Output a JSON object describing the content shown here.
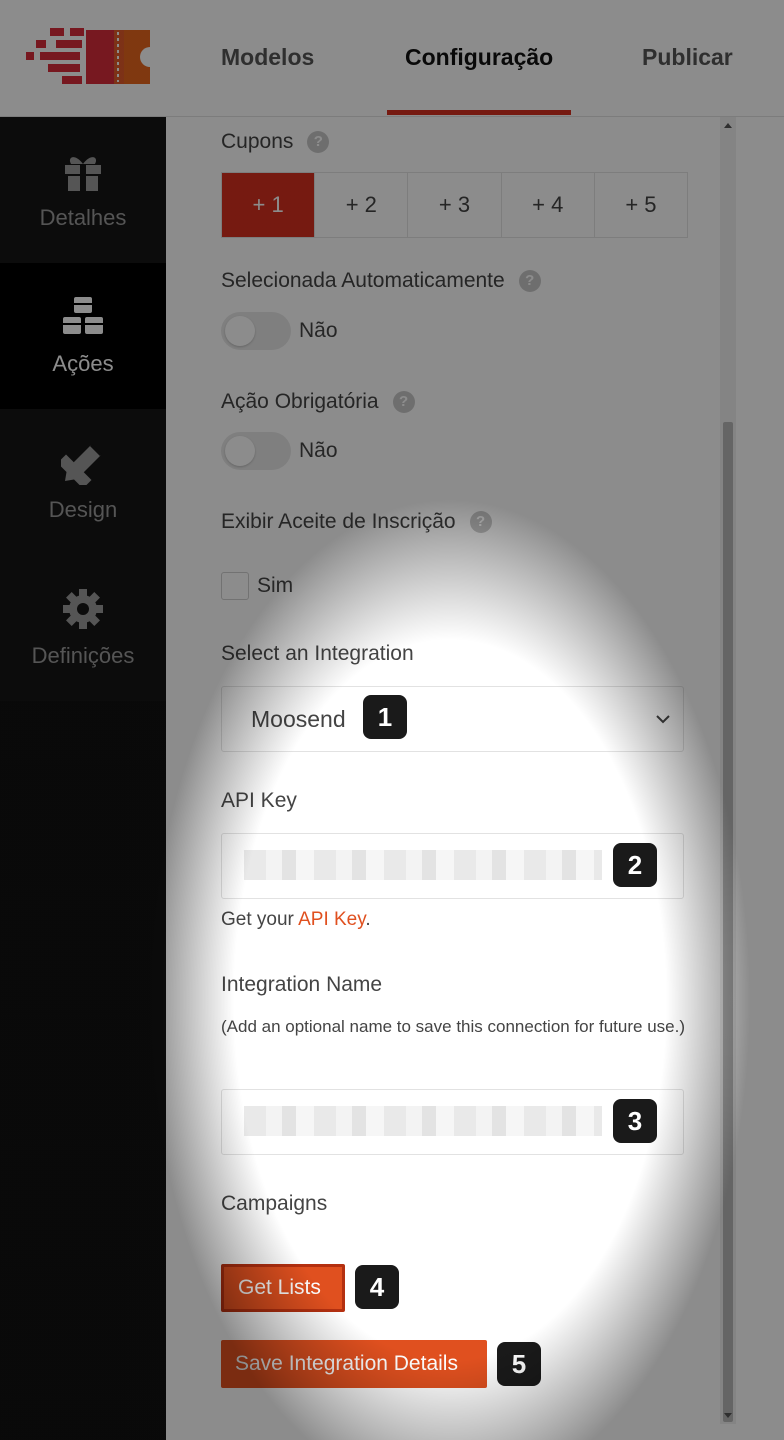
{
  "header": {
    "tabs": [
      {
        "label": "Modelos"
      },
      {
        "label": "Configuração"
      },
      {
        "label": "Publicar"
      }
    ],
    "accent_color": "#d6301f"
  },
  "sidebar": {
    "items": [
      {
        "label": "Detalhes",
        "icon": "gift-icon"
      },
      {
        "label": "Ações",
        "icon": "cubes-icon"
      },
      {
        "label": "Design",
        "icon": "pencil-ruler-icon"
      },
      {
        "label": "Definições",
        "icon": "gear-icon"
      }
    ],
    "active": "Ações"
  },
  "form": {
    "coupons": {
      "label": "Cupons",
      "options": [
        "+ 1",
        "+ 2",
        "+ 3",
        "+ 4",
        "+ 5"
      ],
      "selected": "+ 1"
    },
    "auto_selected": {
      "label": "Selecionada Automaticamente",
      "value": "Não"
    },
    "required_action": {
      "label": "Ação Obrigatória",
      "value": "Não"
    },
    "show_opt_in": {
      "label": "Exibir Aceite de Inscrição",
      "checkbox_label": "Sim"
    },
    "integration": {
      "label": "Select an Integration",
      "selected": "Moosend",
      "badge": "1"
    },
    "api_key": {
      "label": "API Key",
      "badge": "2",
      "hint_prefix": "Get your ",
      "hint_link": "API Key",
      "hint_suffix": "."
    },
    "integration_name": {
      "label": "Integration Name",
      "note": "(Add an optional name to save this connection for future use.)",
      "badge": "3"
    },
    "campaigns": {
      "label": "Campaigns"
    },
    "get_lists": {
      "label": "Get Lists",
      "badge": "4"
    },
    "save": {
      "label": "Save Integration Details",
      "badge": "5"
    }
  }
}
